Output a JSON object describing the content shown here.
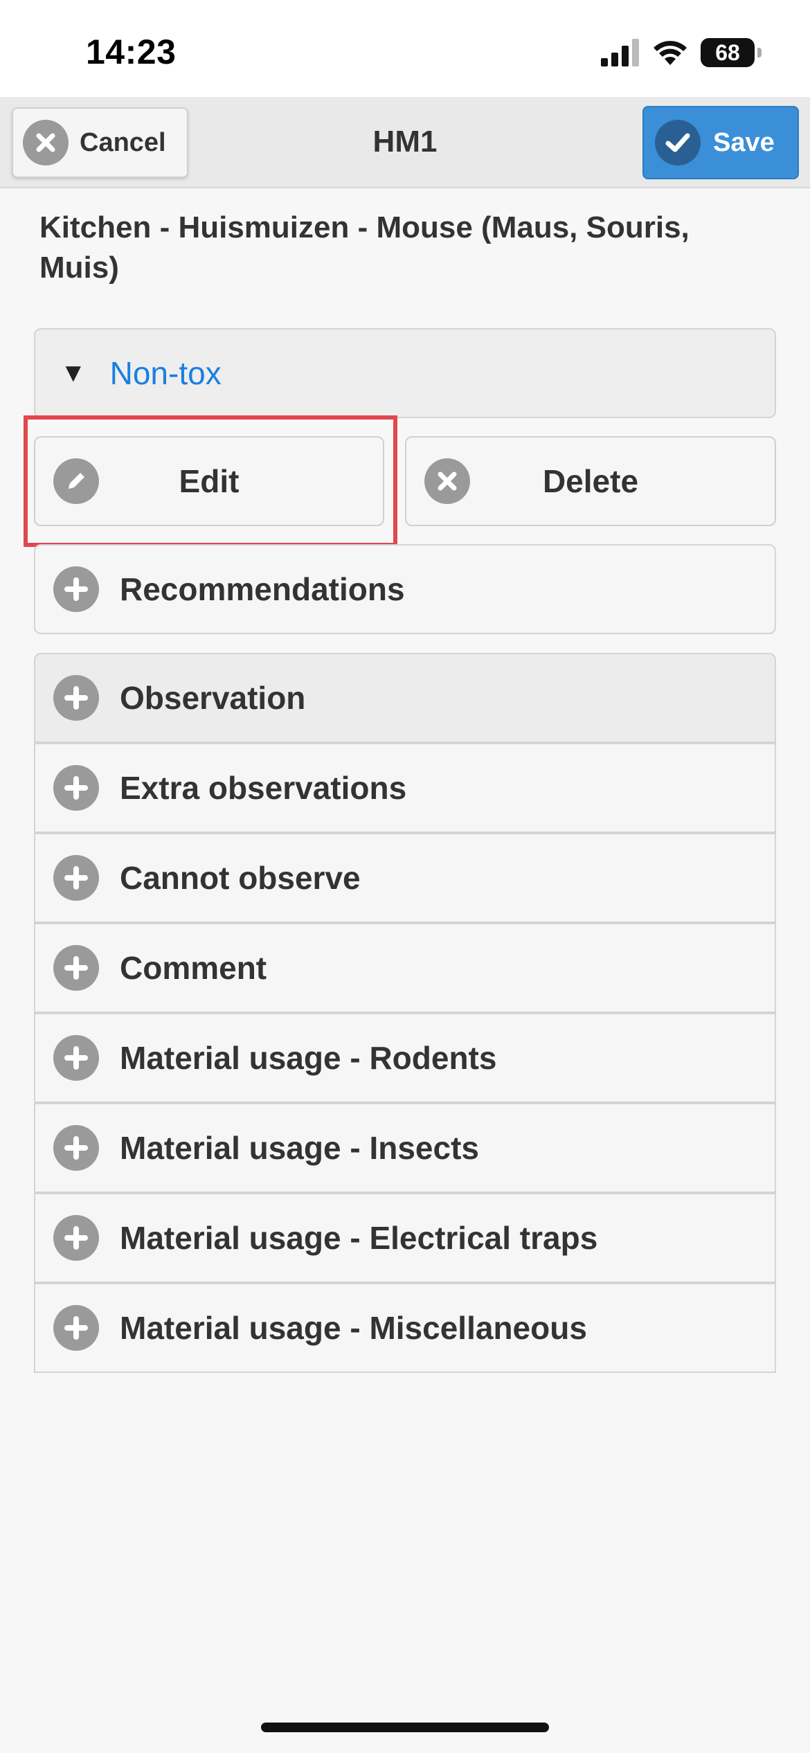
{
  "status_bar": {
    "time": "14:23",
    "battery": "68",
    "icons": [
      "cellular-signal-icon",
      "wifi-icon",
      "battery-icon"
    ]
  },
  "header": {
    "title": "HM1",
    "cancel_label": "Cancel",
    "save_label": "Save"
  },
  "subtitle": "Kitchen - Huismuizen - Mouse (Maus, Souris, Muis)",
  "collapsible": {
    "label": "Non-tox",
    "expanded": true
  },
  "actions": {
    "edit_label": "Edit",
    "delete_label": "Delete"
  },
  "sections": [
    {
      "label": "Recommendations"
    },
    {
      "label": "Observation"
    },
    {
      "label": "Extra observations"
    },
    {
      "label": "Cannot observe"
    },
    {
      "label": "Comment"
    },
    {
      "label": "Material usage - Rodents"
    },
    {
      "label": "Material usage - Insects"
    },
    {
      "label": "Material usage - Electrical traps"
    },
    {
      "label": "Material usage - Miscellaneous"
    }
  ],
  "colors": {
    "accent_blue": "#3a8fd8",
    "link_blue": "#1a7fe0",
    "highlight_red": "#e2474e",
    "icon_gray": "#9a9a9a"
  }
}
